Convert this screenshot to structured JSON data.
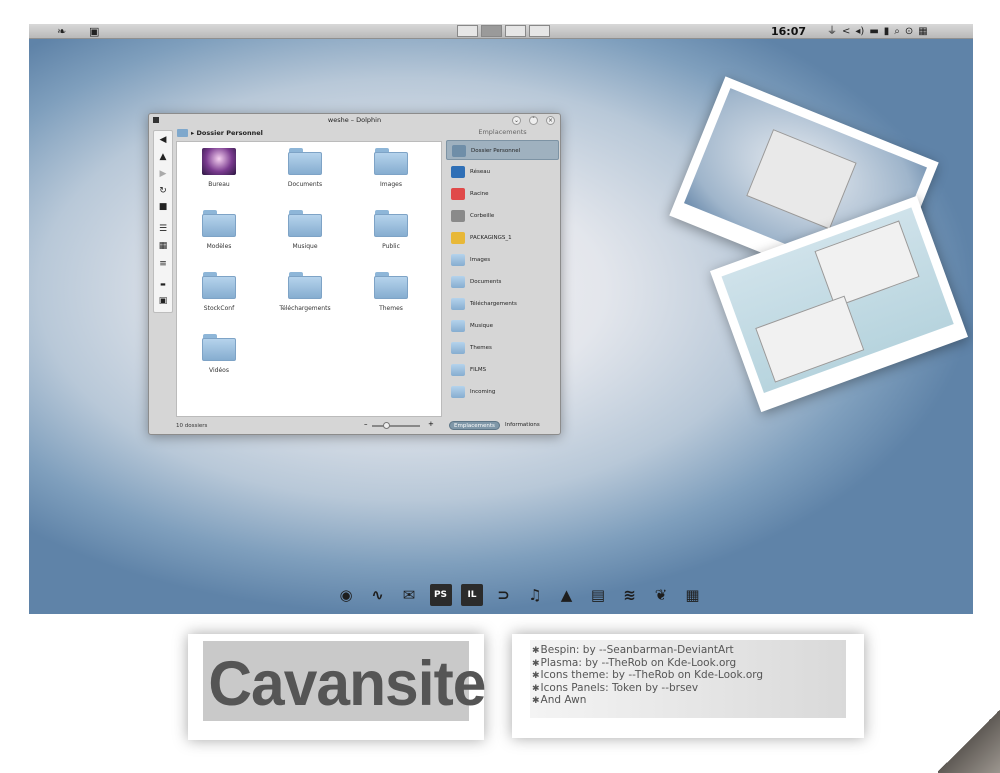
{
  "topbar": {
    "clock": "16:07",
    "left_icons": [
      "leaf-icon",
      "book-icon"
    ],
    "tray_icons": [
      "usb-icon",
      "share-icon",
      "volume-icon",
      "battery-icon",
      "clipboard-icon",
      "search-icon",
      "menu-icon",
      "wifi-icon"
    ],
    "tray_glyphs": [
      "⏚",
      "<",
      "◂)",
      "▬",
      "▮",
      "⌕",
      "⊙",
      "▦"
    ],
    "pager_count": 4,
    "pager_active": 2
  },
  "dolphin": {
    "title": "weshe – Dolphin",
    "breadcrumb": "Dossier Personnel",
    "items": [
      "Bureau",
      "Documents",
      "Images",
      "Modèles",
      "Musique",
      "Public",
      "StockConf",
      "Téléchargements",
      "Themes",
      "Vidéos"
    ],
    "sidebar_title": "Emplacements",
    "places": [
      "Dossier Personnel",
      "Réseau",
      "Racine",
      "Corbeille",
      "PACKAGINGS_1",
      "Images",
      "Documents",
      "Téléchargements",
      "Musique",
      "Themes",
      "FILMS",
      "Incoming"
    ],
    "status": "10 dossiers",
    "panel_tabs": [
      "Emplacements",
      "Informations"
    ],
    "zoom_minus": "–",
    "zoom_plus": "+"
  },
  "dock": {
    "icons": [
      "firefox-icon",
      "rss-icon",
      "mail-icon",
      "photoshop-icon",
      "illustrator-icon",
      "chat-icon",
      "music-icon",
      "vlc-icon",
      "notebook-icon",
      "wine-icon",
      "leaf-icon",
      "folder-icon"
    ],
    "labels": [
      "",
      "",
      "",
      "PS",
      "IL",
      "",
      "",
      "",
      "",
      "",
      "",
      ""
    ]
  },
  "banner": {
    "title": "Cavansite",
    "credits": [
      "Bespin: by --Seanbarman-DeviantArt",
      "Plasma: by --TheRob on Kde-Look.org",
      "Icons theme: by --TheRob on Kde-Look.org",
      "Icons Panels: Token by --brsev",
      "And Awn"
    ]
  },
  "colors": {
    "accent": "#9fb1bf",
    "folder": "#86add0",
    "banner_text": "#555555"
  }
}
